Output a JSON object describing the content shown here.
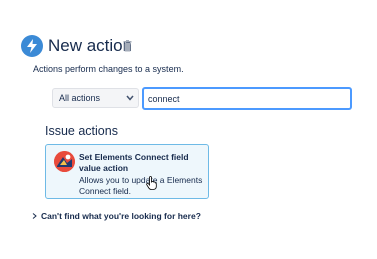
{
  "header": {
    "title": "New action",
    "icon": "lightning-bolt-icon",
    "icon_color": "#3b8ad6",
    "delete_icon": "trash-icon"
  },
  "subtitle": "Actions perform changes to a system.",
  "filter": {
    "selected": "All actions",
    "search_value": "connect",
    "focus_color": "#4c9aff"
  },
  "section": {
    "heading": "Issue actions",
    "card": {
      "title": "Set Elements Connect field value action",
      "description": "Allows you to update a Elements Connect field.",
      "icon": "elements-connect-logo-icon",
      "border_color": "#6ebae6",
      "background_color": "#eef7fc"
    }
  },
  "help": {
    "label": "Can't find what you're looking for here?"
  }
}
